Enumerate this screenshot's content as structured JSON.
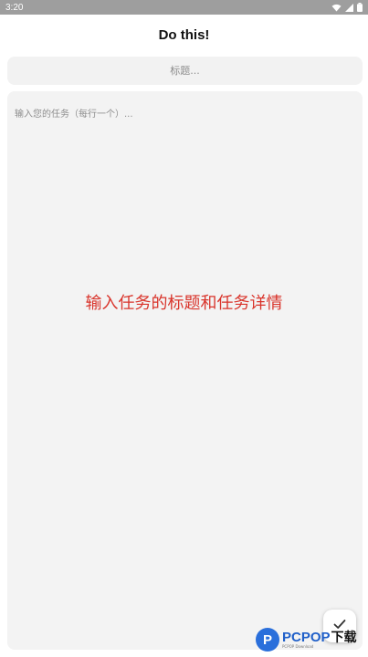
{
  "status_bar": {
    "time": "3:20"
  },
  "header": {
    "title": "Do this!"
  },
  "form": {
    "title_placeholder": "标题...",
    "tasks_placeholder": "输入您的任务（每行一个）..."
  },
  "overlay": {
    "caption": "输入任务的标题和任务详情"
  },
  "fab": {
    "icon": "check-icon"
  },
  "watermark": {
    "badge_letter": "P",
    "brand": "PCPOP",
    "suffix": "下载",
    "tagline": "PCPOP Download"
  },
  "colors": {
    "status_bar_bg": "#9e9e9e",
    "input_bg": "#f2f2f2",
    "caption": "#d9342b",
    "watermark_brand": "#1f5fc9"
  }
}
